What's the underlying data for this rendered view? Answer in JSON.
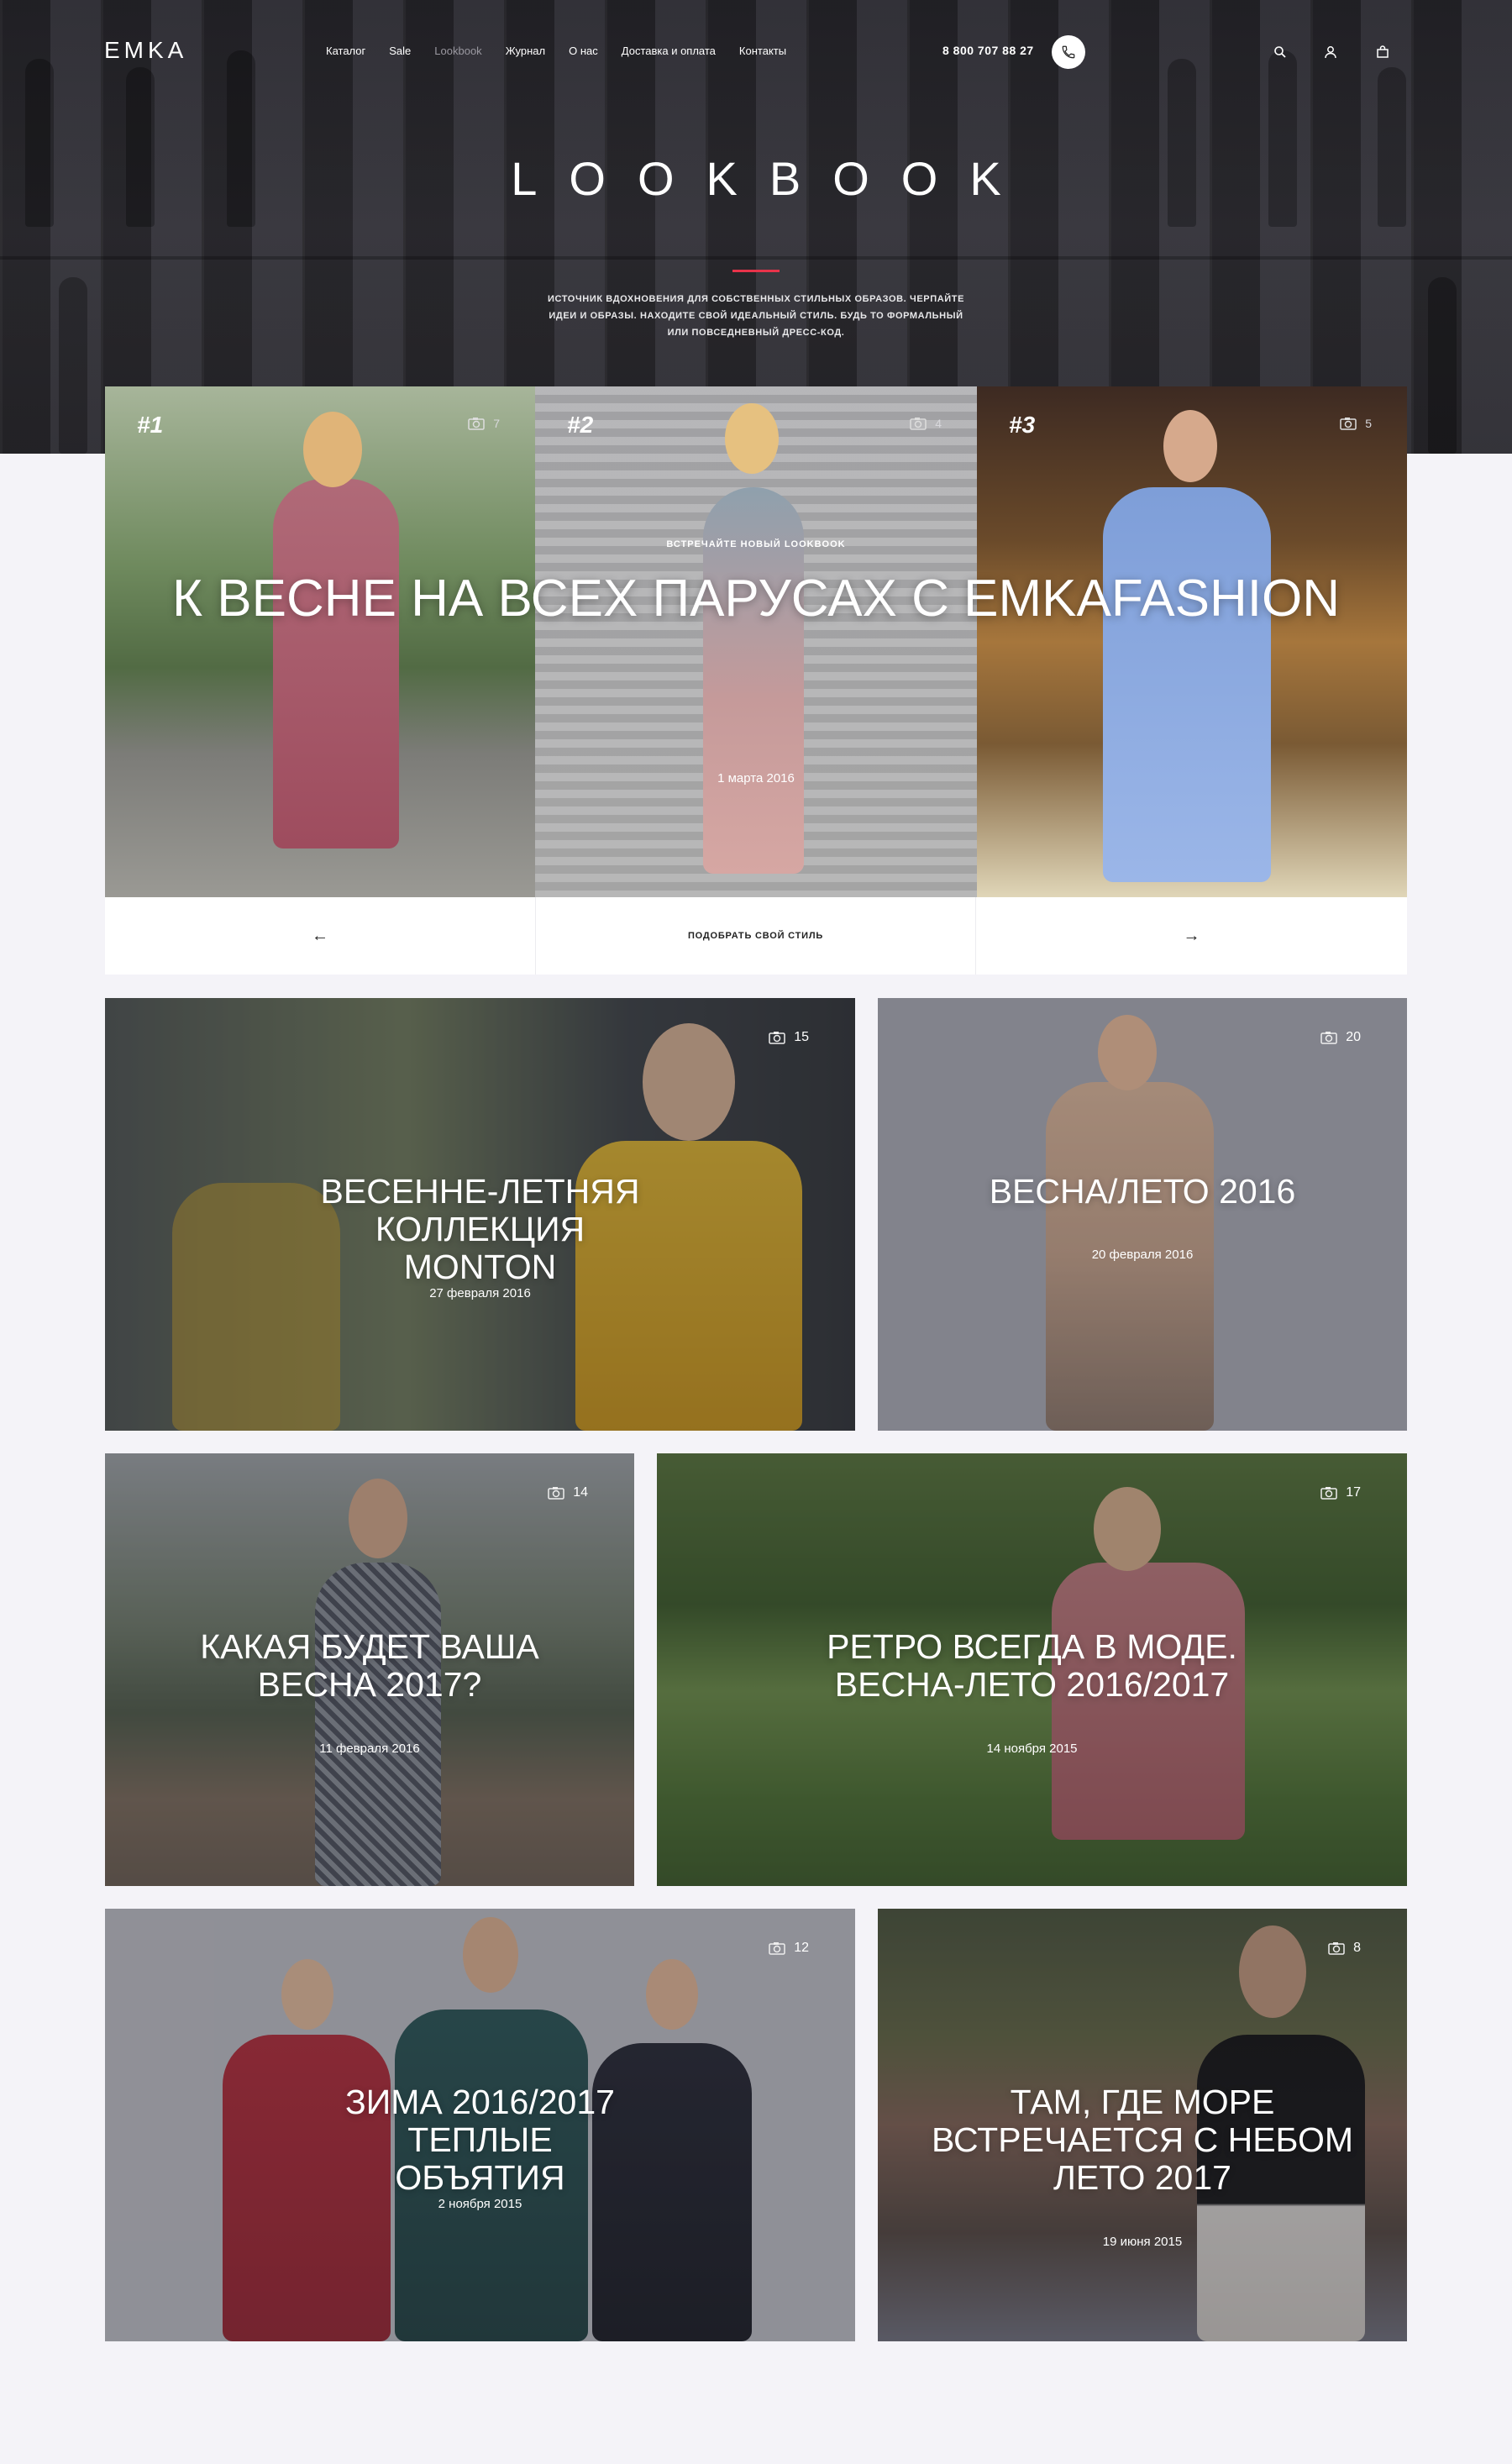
{
  "header": {
    "logo": "EMKA",
    "nav": [
      "Каталог",
      "Sale",
      "Lookbook",
      "Журнал",
      "О нас",
      "Доставка и оплата",
      "Контакты"
    ],
    "active_nav": "Lookbook",
    "phone": "8 800 707 88 27",
    "icons": [
      "phone-icon",
      "search-icon",
      "user-icon",
      "bag-icon"
    ]
  },
  "hero": {
    "title": "LOOKBOOK",
    "subtitle": "Источник вдохновения для собственных стильных образов. Черпайте идеи и образы. Находите свой идеальный стиль. Будь то формальный или повседневный дресс-код.",
    "accent": "#e8334a"
  },
  "slider": {
    "slides": [
      {
        "num": "#1",
        "photos": "7"
      },
      {
        "num": "#2",
        "photos": "4"
      },
      {
        "num": "#3",
        "photos": "5"
      }
    ],
    "kicker": "Встречайте новый lookbook",
    "title": "К весне на всех парусах с EMKAFASHION",
    "date": "1 марта 2016",
    "prev": "←",
    "cta": "Подобрать свой стиль",
    "next": "→"
  },
  "cards": [
    {
      "title": "Весенне-летняя коллекция MONTON",
      "date": "27 февраля 2016",
      "photos": "15"
    },
    {
      "title": "Весна/Лето 2016",
      "date": "20 февраля 2016",
      "photos": "20"
    },
    {
      "title": "Какая будет ваша весна 2017?",
      "date": "11 февраля 2016",
      "photos": "14"
    },
    {
      "title": "Ретро всегда в моде. Весна-лето 2016/2017",
      "date": "14 ноября 2015",
      "photos": "17"
    },
    {
      "title": "Зима 2016/2017 теплые объятия",
      "date": "2 ноября 2015",
      "photos": "12"
    },
    {
      "title": "Там, где море встречается с небом лето 2017",
      "date": "19 июня 2015",
      "photos": "8"
    }
  ]
}
